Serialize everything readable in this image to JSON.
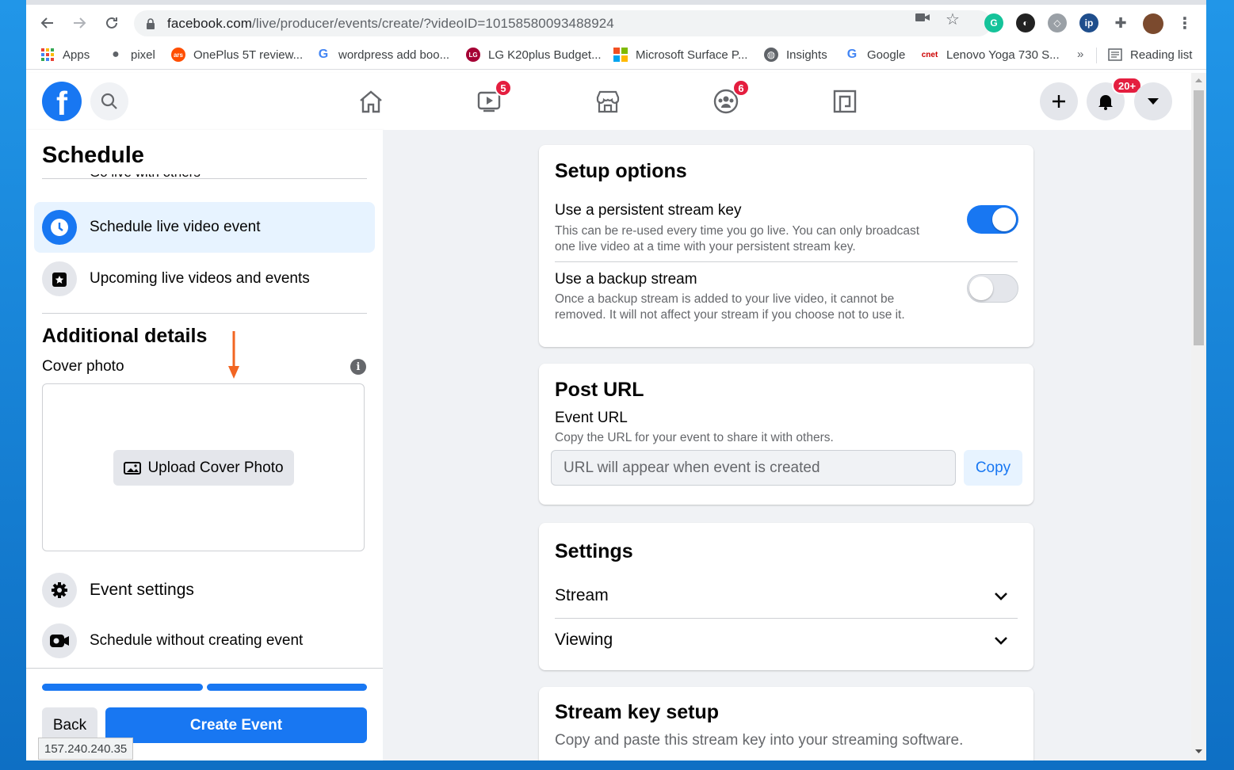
{
  "browser": {
    "url_host": "facebook.com",
    "url_path": "/live/producer/events/create/?videoID=10158580093488924",
    "bookmarks": [
      {
        "label": "Apps",
        "icon": "apps-grid-icon"
      },
      {
        "label": "pixel",
        "icon": "apple-icon"
      },
      {
        "label": "OnePlus 5T review...",
        "icon": "ars-icon"
      },
      {
        "label": "wordpress add boo...",
        "icon": "google-icon"
      },
      {
        "label": "LG K20plus Budget...",
        "icon": "lg-icon"
      },
      {
        "label": "Microsoft Surface P...",
        "icon": "microsoft-icon"
      },
      {
        "label": "Insights",
        "icon": "globe-icon"
      },
      {
        "label": "Google",
        "icon": "google-icon"
      },
      {
        "label": "Lenovo Yoga 730 S...",
        "icon": "cnet-icon"
      }
    ],
    "more_label": "»",
    "reading_list": "Reading list"
  },
  "fb_header": {
    "logo_letter": "f",
    "watch_badge": "5",
    "groups_badge": "6",
    "notifications_badge": "20+"
  },
  "sidebar": {
    "title": "Schedule",
    "cut_item": "Go live with others",
    "items": [
      {
        "label": "Schedule live video event"
      },
      {
        "label": "Upcoming live videos and events"
      }
    ],
    "additional_title": "Additional details",
    "cover_label": "Cover photo",
    "info_glyph": "i",
    "upload_label": "Upload Cover Photo",
    "event_settings": "Event settings",
    "schedule_without": "Schedule without creating event",
    "back_label": "Back",
    "create_label": "Create Event",
    "status_ip": "157.240.240.35"
  },
  "setup": {
    "title": "Setup options",
    "persistent_title": "Use a persistent stream key",
    "persistent_desc": "This can be re-used every time you go live. You can only broadcast one live video at a time with your persistent stream key.",
    "persistent_on": true,
    "backup_title": "Use a backup stream",
    "backup_desc": "Once a backup stream is added to your live video, it cannot be removed. It will not affect your stream if you choose not to use it.",
    "backup_on": false
  },
  "post_url": {
    "title": "Post URL",
    "event_url_label": "Event URL",
    "event_url_desc": "Copy the URL for your event to share it with others.",
    "placeholder": "URL will appear when event is created",
    "copy_label": "Copy"
  },
  "settings": {
    "title": "Settings",
    "rows": [
      {
        "label": "Stream"
      },
      {
        "label": "Viewing"
      }
    ]
  },
  "stream_key": {
    "title": "Stream key setup",
    "desc": "Copy and paste this stream key into your streaming software."
  },
  "colors": {
    "fb_blue": "#1877f2",
    "badge_red": "#e41e3f",
    "active_bg": "#e7f3ff"
  }
}
